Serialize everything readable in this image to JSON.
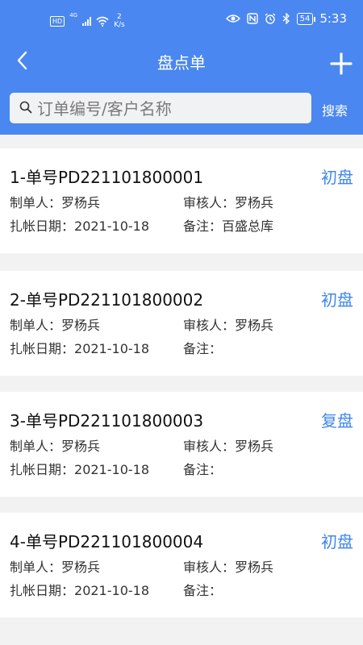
{
  "status_bar": {
    "hd": "HD",
    "network_type": "4G",
    "net_speed_value": "2",
    "net_speed_unit": "K/s",
    "battery": "54",
    "time": "5:33"
  },
  "header": {
    "title": "盘点单",
    "back_icon": "chevron-left-icon",
    "add_icon": "plus-icon"
  },
  "search": {
    "placeholder": "订单编号/客户名称",
    "value": "",
    "button_label": "搜索"
  },
  "orders": [
    {
      "number": "1-单号PD221101800001",
      "status": "初盘",
      "creator_label": "制单人：",
      "creator": "罗杨兵",
      "reviewer_label": "审核人：",
      "reviewer": "罗杨兵",
      "date_label": "扎帐日期：",
      "date": "2021-10-18",
      "remark_label": "备注：",
      "remark": "百盛总库"
    },
    {
      "number": "2-单号PD221101800002",
      "status": "初盘",
      "creator_label": "制单人：",
      "creator": "罗杨兵",
      "reviewer_label": "审核人：",
      "reviewer": "罗杨兵",
      "date_label": "扎帐日期：",
      "date": "2021-10-18",
      "remark_label": "备注：",
      "remark": ""
    },
    {
      "number": "3-单号PD221101800003",
      "status": "复盘",
      "creator_label": "制单人：",
      "creator": "罗杨兵",
      "reviewer_label": "审核人：",
      "reviewer": "罗杨兵",
      "date_label": "扎帐日期：",
      "date": "2021-10-18",
      "remark_label": "备注：",
      "remark": ""
    },
    {
      "number": "4-单号PD221101800004",
      "status": "初盘",
      "creator_label": "制单人：",
      "creator": "罗杨兵",
      "reviewer_label": "审核人：",
      "reviewer": "罗杨兵",
      "date_label": "扎帐日期：",
      "date": "2021-10-18",
      "remark_label": "备注：",
      "remark": ""
    }
  ]
}
